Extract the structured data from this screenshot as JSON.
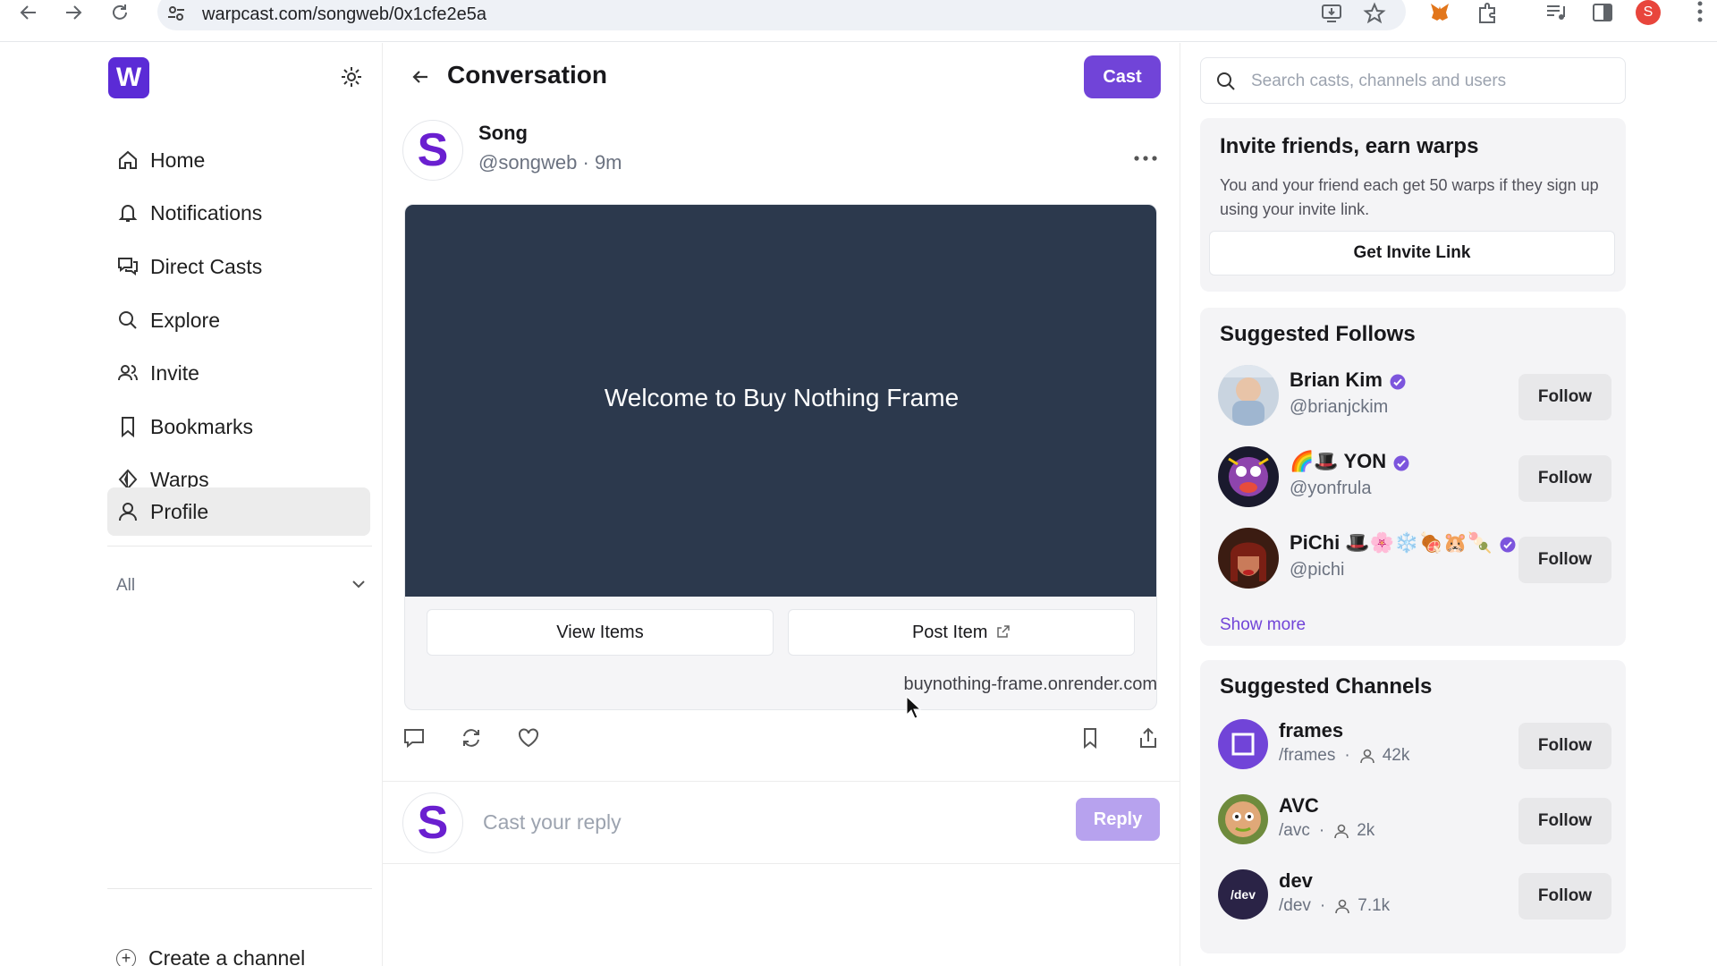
{
  "browser": {
    "url": "warpcast.com/songweb/0x1cfe2e5a",
    "profile_initial": "S"
  },
  "sidebar": {
    "logo": "W",
    "items": [
      {
        "label": "Home",
        "icon": "home-icon"
      },
      {
        "label": "Notifications",
        "icon": "bell-icon"
      },
      {
        "label": "Direct Casts",
        "icon": "chat-icon"
      },
      {
        "label": "Explore",
        "icon": "search-icon"
      },
      {
        "label": "Invite",
        "icon": "users-icon"
      },
      {
        "label": "Bookmarks",
        "icon": "bookmark-icon"
      },
      {
        "label": "Warps",
        "icon": "warps-icon"
      },
      {
        "label": "Profile",
        "icon": "user-icon",
        "active": true
      }
    ],
    "filter_label": "All",
    "create_channel": "Create a channel"
  },
  "conversation": {
    "title": "Conversation",
    "cast_button": "Cast",
    "author": {
      "initial": "S",
      "name": "Song",
      "handle_time": "@songweb · 9m"
    },
    "frame": {
      "text": "Welcome to Buy Nothing Frame",
      "buttons": [
        "View Items",
        "Post Item"
      ],
      "domain": "buynothing-frame.onrender.com"
    },
    "reply": {
      "avatar_initial": "S",
      "placeholder": "Cast your reply",
      "button": "Reply"
    }
  },
  "right": {
    "search_placeholder": "Search casts, channels and users",
    "invite": {
      "title": "Invite friends, earn warps",
      "description": "You and your friend each get 50 warps if they sign up using your invite link.",
      "button": "Get Invite Link"
    },
    "suggested_follows": {
      "title": "Suggested Follows",
      "users": [
        {
          "name": "Brian Kim",
          "handle": "@brianjckim",
          "follow": "Follow"
        },
        {
          "name": "🌈🎩 YON",
          "handle": "@yonfrula",
          "follow": "Follow"
        },
        {
          "name": "PiChi 🎩🌸❄️🍖🐹🍡",
          "handle": "@pichi",
          "follow": "Follow"
        }
      ],
      "show_more": "Show more"
    },
    "suggested_channels": {
      "title": "Suggested Channels",
      "channels": [
        {
          "name": "frames",
          "path": "/frames",
          "members": "42k",
          "follow": "Follow"
        },
        {
          "name": "AVC",
          "path": "/avc",
          "members": "2k",
          "follow": "Follow"
        },
        {
          "name": "dev",
          "path": "/dev",
          "members": "7.1k",
          "follow": "Follow",
          "avatar_text": "/dev"
        }
      ]
    }
  },
  "colors": {
    "accent": "#7144d8",
    "frame_bg": "#2c394d",
    "reply_disabled": "#b7a2ee"
  }
}
